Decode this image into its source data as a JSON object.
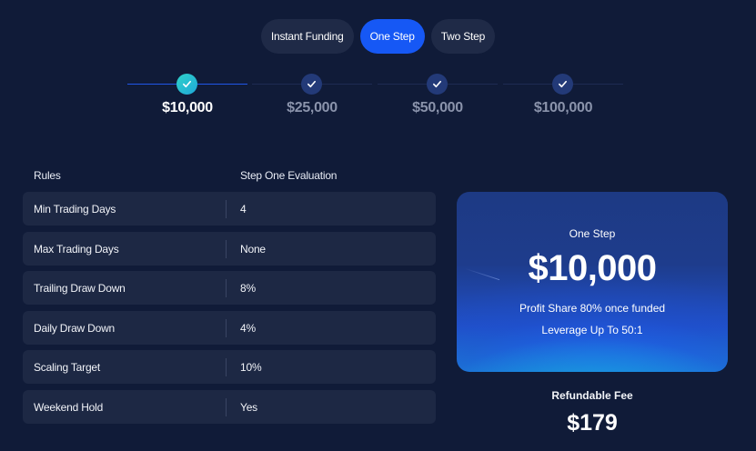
{
  "tabs": [
    {
      "label": "Instant Funding",
      "active": false
    },
    {
      "label": "One Step",
      "active": true
    },
    {
      "label": "Two Step",
      "active": false
    }
  ],
  "accounts": [
    {
      "amount": "$10,000",
      "active": true
    },
    {
      "amount": "$25,000",
      "active": false
    },
    {
      "amount": "$50,000",
      "active": false
    },
    {
      "amount": "$100,000",
      "active": false
    }
  ],
  "rules": {
    "header": {
      "rule": "Rules",
      "value": "Step One Evaluation"
    },
    "rows": [
      {
        "rule": "Min Trading Days",
        "value": "4"
      },
      {
        "rule": "Max Trading Days",
        "value": "None"
      },
      {
        "rule": "Trailing Draw Down",
        "value": "8%"
      },
      {
        "rule": "Daily Draw Down",
        "value": "4%"
      },
      {
        "rule": "Scaling Target",
        "value": "10%"
      },
      {
        "rule": "Weekend Hold",
        "value": "Yes"
      }
    ]
  },
  "card": {
    "plan": "One Step",
    "price": "$10,000",
    "profit_share": "Profit Share 80% once funded",
    "leverage": "Leverage Up To 50:1"
  },
  "fee": {
    "label": "Refundable Fee",
    "value": "$179"
  },
  "icons": {
    "step_marker": "check-icon"
  },
  "colors": {
    "background": "#101b38",
    "accent": "#1658f5",
    "active_step": "#2fd3c9"
  }
}
